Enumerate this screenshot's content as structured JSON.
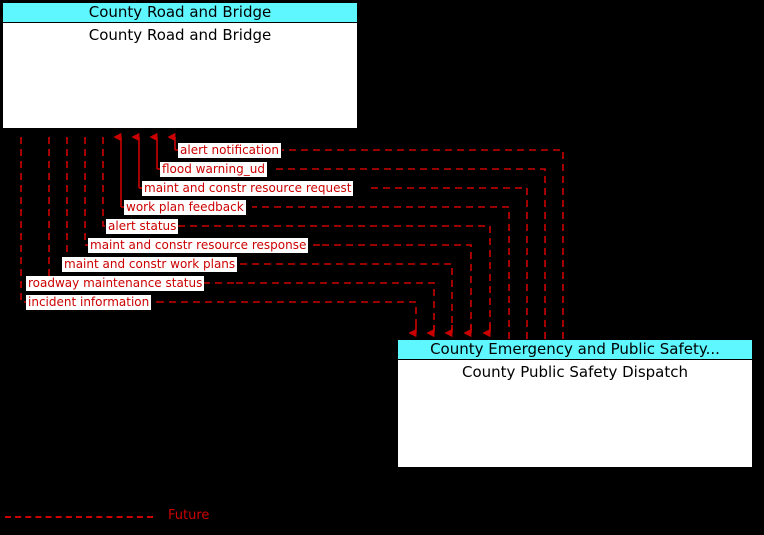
{
  "diagram": {
    "type": "interface-context-diagram",
    "background_color": "#000000",
    "flow_color": "#CC0000",
    "entity_header_color": "#5FF7FF",
    "entity_body_color": "#FFFFFF"
  },
  "entities": [
    {
      "id": "road-bridge",
      "header": "County Road and Bridge",
      "name": "County Road and Bridge"
    },
    {
      "id": "public-safety",
      "header": "County Emergency and Public Safety...",
      "name": "County Public Safety Dispatch"
    }
  ],
  "flows": [
    {
      "label": "alert notification",
      "direction": "to-road-bridge"
    },
    {
      "label": "flood warning_ud",
      "direction": "to-road-bridge"
    },
    {
      "label": "maint and constr resource request",
      "direction": "to-road-bridge"
    },
    {
      "label": "work plan feedback",
      "direction": "to-road-bridge"
    },
    {
      "label": "alert status",
      "direction": "to-public-safety"
    },
    {
      "label": "maint and constr resource response",
      "direction": "to-public-safety"
    },
    {
      "label": "maint and constr work plans",
      "direction": "to-public-safety"
    },
    {
      "label": "roadway maintenance status",
      "direction": "to-public-safety"
    },
    {
      "label": "incident information",
      "direction": "to-public-safety"
    }
  ],
  "legend": {
    "items": [
      {
        "label": "Future",
        "style": "dashed",
        "color": "#CC0000"
      }
    ]
  }
}
